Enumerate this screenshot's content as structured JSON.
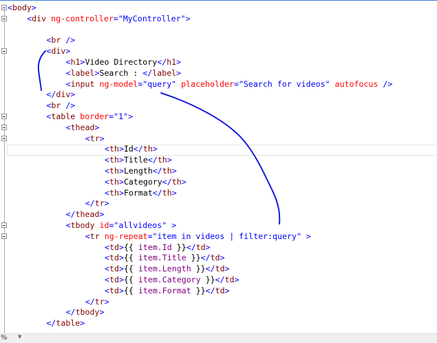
{
  "editor": {
    "lines": [
      {
        "indent": 0,
        "fold": true,
        "tokens": [
          [
            "d",
            "<"
          ],
          [
            "n",
            "body"
          ],
          [
            "d",
            ">"
          ]
        ]
      },
      {
        "indent": 4,
        "fold": true,
        "tokens": [
          [
            "d",
            "<"
          ],
          [
            "n",
            "div"
          ],
          [
            "x",
            " "
          ],
          [
            "a",
            "ng-controller"
          ],
          [
            "d",
            "="
          ],
          [
            "v",
            "\"MyController\""
          ],
          [
            "d",
            ">"
          ]
        ]
      },
      {
        "indent": 0,
        "fold": false,
        "tokens": []
      },
      {
        "indent": 8,
        "fold": false,
        "tokens": [
          [
            "d",
            "<"
          ],
          [
            "n",
            "br"
          ],
          [
            "x",
            " "
          ],
          [
            "d",
            "/>"
          ]
        ]
      },
      {
        "indent": 8,
        "fold": true,
        "tokens": [
          [
            "d",
            "<"
          ],
          [
            "n",
            "div"
          ],
          [
            "d",
            ">"
          ]
        ]
      },
      {
        "indent": 12,
        "fold": false,
        "tokens": [
          [
            "d",
            "<"
          ],
          [
            "n",
            "h1"
          ],
          [
            "d",
            ">"
          ],
          [
            "x",
            "Video Directory"
          ],
          [
            "d",
            "</"
          ],
          [
            "n",
            "h1"
          ],
          [
            "d",
            ">"
          ]
        ]
      },
      {
        "indent": 12,
        "fold": false,
        "tokens": [
          [
            "d",
            "<"
          ],
          [
            "n",
            "label"
          ],
          [
            "d",
            ">"
          ],
          [
            "x",
            "Search : "
          ],
          [
            "d",
            "</"
          ],
          [
            "n",
            "label"
          ],
          [
            "d",
            ">"
          ]
        ]
      },
      {
        "indent": 12,
        "fold": false,
        "tokens": [
          [
            "d",
            "<"
          ],
          [
            "n",
            "input"
          ],
          [
            "x",
            " "
          ],
          [
            "a",
            "ng-model"
          ],
          [
            "d",
            "="
          ],
          [
            "v",
            "\"query\""
          ],
          [
            "x",
            " "
          ],
          [
            "a",
            "placeholder"
          ],
          [
            "d",
            "="
          ],
          [
            "v",
            "\"Search for videos\""
          ],
          [
            "x",
            " "
          ],
          [
            "a",
            "autofocus"
          ],
          [
            "x",
            " "
          ],
          [
            "d",
            "/>"
          ]
        ]
      },
      {
        "indent": 8,
        "fold": false,
        "tokens": [
          [
            "d",
            "</"
          ],
          [
            "n",
            "div"
          ],
          [
            "d",
            ">"
          ]
        ]
      },
      {
        "indent": 8,
        "fold": false,
        "tokens": [
          [
            "d",
            "<"
          ],
          [
            "n",
            "br"
          ],
          [
            "x",
            " "
          ],
          [
            "d",
            "/>"
          ]
        ]
      },
      {
        "indent": 8,
        "fold": true,
        "tokens": [
          [
            "d",
            "<"
          ],
          [
            "n",
            "table"
          ],
          [
            "x",
            " "
          ],
          [
            "a",
            "border"
          ],
          [
            "d",
            "="
          ],
          [
            "v",
            "\"1\""
          ],
          [
            "d",
            ">"
          ]
        ]
      },
      {
        "indent": 12,
        "fold": true,
        "tokens": [
          [
            "d",
            "<"
          ],
          [
            "n",
            "thead"
          ],
          [
            "d",
            ">"
          ]
        ]
      },
      {
        "indent": 16,
        "fold": true,
        "tokens": [
          [
            "d",
            "<"
          ],
          [
            "n",
            "tr"
          ],
          [
            "d",
            ">"
          ]
        ]
      },
      {
        "indent": 20,
        "fold": false,
        "tokens": [
          [
            "d",
            "<"
          ],
          [
            "n",
            "th"
          ],
          [
            "d",
            ">"
          ],
          [
            "x",
            "Id"
          ],
          [
            "d",
            "</"
          ],
          [
            "n",
            "th"
          ],
          [
            "d",
            ">"
          ]
        ]
      },
      {
        "indent": 20,
        "fold": false,
        "tokens": [
          [
            "d",
            "<"
          ],
          [
            "n",
            "th"
          ],
          [
            "d",
            ">"
          ],
          [
            "x",
            "Title"
          ],
          [
            "d",
            "</"
          ],
          [
            "n",
            "th"
          ],
          [
            "d",
            ">"
          ]
        ]
      },
      {
        "indent": 20,
        "fold": false,
        "tokens": [
          [
            "d",
            "<"
          ],
          [
            "n",
            "th"
          ],
          [
            "d",
            ">"
          ],
          [
            "x",
            "Length"
          ],
          [
            "d",
            "</"
          ],
          [
            "n",
            "th"
          ],
          [
            "d",
            ">"
          ]
        ]
      },
      {
        "indent": 20,
        "fold": false,
        "tokens": [
          [
            "d",
            "<"
          ],
          [
            "n",
            "th"
          ],
          [
            "d",
            ">"
          ],
          [
            "x",
            "Category"
          ],
          [
            "d",
            "</"
          ],
          [
            "n",
            "th"
          ],
          [
            "d",
            ">"
          ]
        ]
      },
      {
        "indent": 20,
        "fold": false,
        "tokens": [
          [
            "d",
            "<"
          ],
          [
            "n",
            "th"
          ],
          [
            "d",
            ">"
          ],
          [
            "x",
            "Format"
          ],
          [
            "d",
            "</"
          ],
          [
            "n",
            "th"
          ],
          [
            "d",
            ">"
          ]
        ]
      },
      {
        "indent": 16,
        "fold": false,
        "tokens": [
          [
            "d",
            "</"
          ],
          [
            "n",
            "tr"
          ],
          [
            "d",
            ">"
          ]
        ]
      },
      {
        "indent": 12,
        "fold": false,
        "tokens": [
          [
            "d",
            "</"
          ],
          [
            "n",
            "thead"
          ],
          [
            "d",
            ">"
          ]
        ]
      },
      {
        "indent": 12,
        "fold": true,
        "tokens": [
          [
            "d",
            "<"
          ],
          [
            "n",
            "tbody"
          ],
          [
            "x",
            " "
          ],
          [
            "a",
            "id"
          ],
          [
            "d",
            "="
          ],
          [
            "v",
            "\"allvideos\""
          ],
          [
            "x",
            " "
          ],
          [
            "d",
            ">"
          ]
        ]
      },
      {
        "indent": 16,
        "fold": true,
        "tokens": [
          [
            "d",
            "<"
          ],
          [
            "n",
            "tr"
          ],
          [
            "x",
            " "
          ],
          [
            "a",
            "ng-repeat"
          ],
          [
            "d",
            "="
          ],
          [
            "v",
            "\"item in videos | filter:query\""
          ],
          [
            "x",
            " "
          ],
          [
            "d",
            ">"
          ]
        ]
      },
      {
        "indent": 20,
        "fold": false,
        "tokens": [
          [
            "d",
            "<"
          ],
          [
            "n",
            "td"
          ],
          [
            "d",
            ">"
          ],
          [
            "x",
            "{{ "
          ],
          [
            "e",
            "item.Id"
          ],
          [
            "x",
            " }}"
          ],
          [
            "d",
            "</"
          ],
          [
            "n",
            "td"
          ],
          [
            "d",
            ">"
          ]
        ]
      },
      {
        "indent": 20,
        "fold": false,
        "tokens": [
          [
            "d",
            "<"
          ],
          [
            "n",
            "td"
          ],
          [
            "d",
            ">"
          ],
          [
            "x",
            "{{ "
          ],
          [
            "e",
            "item.Title"
          ],
          [
            "x",
            " }}"
          ],
          [
            "d",
            "</"
          ],
          [
            "n",
            "td"
          ],
          [
            "d",
            ">"
          ]
        ]
      },
      {
        "indent": 20,
        "fold": false,
        "tokens": [
          [
            "d",
            "<"
          ],
          [
            "n",
            "td"
          ],
          [
            "d",
            ">"
          ],
          [
            "x",
            "{{ "
          ],
          [
            "e",
            "item.Length"
          ],
          [
            "x",
            " }}"
          ],
          [
            "d",
            "</"
          ],
          [
            "n",
            "td"
          ],
          [
            "d",
            ">"
          ]
        ]
      },
      {
        "indent": 20,
        "fold": false,
        "tokens": [
          [
            "d",
            "<"
          ],
          [
            "n",
            "td"
          ],
          [
            "d",
            ">"
          ],
          [
            "x",
            "{{ "
          ],
          [
            "e",
            "item.Category"
          ],
          [
            "x",
            " }}"
          ],
          [
            "d",
            "</"
          ],
          [
            "n",
            "td"
          ],
          [
            "d",
            ">"
          ]
        ]
      },
      {
        "indent": 20,
        "fold": false,
        "tokens": [
          [
            "d",
            "<"
          ],
          [
            "n",
            "td"
          ],
          [
            "d",
            ">"
          ],
          [
            "x",
            "{{ "
          ],
          [
            "e",
            "item.Format"
          ],
          [
            "x",
            " }}"
          ],
          [
            "d",
            "</"
          ],
          [
            "n",
            "td"
          ],
          [
            "d",
            ">"
          ]
        ]
      },
      {
        "indent": 16,
        "fold": false,
        "tokens": [
          [
            "d",
            "</"
          ],
          [
            "n",
            "tr"
          ],
          [
            "d",
            ">"
          ]
        ]
      },
      {
        "indent": 12,
        "fold": false,
        "tokens": [
          [
            "d",
            "</"
          ],
          [
            "n",
            "tbody"
          ],
          [
            "d",
            ">"
          ]
        ]
      },
      {
        "indent": 8,
        "fold": false,
        "tokens": [
          [
            "d",
            "</"
          ],
          [
            "n",
            "table"
          ],
          [
            "d",
            ">"
          ]
        ]
      }
    ],
    "current_line": 14
  },
  "status": {
    "zoom_label": "%",
    "dropdown_icon": "chevron-down-icon"
  },
  "ink_color": "#1a1adf"
}
